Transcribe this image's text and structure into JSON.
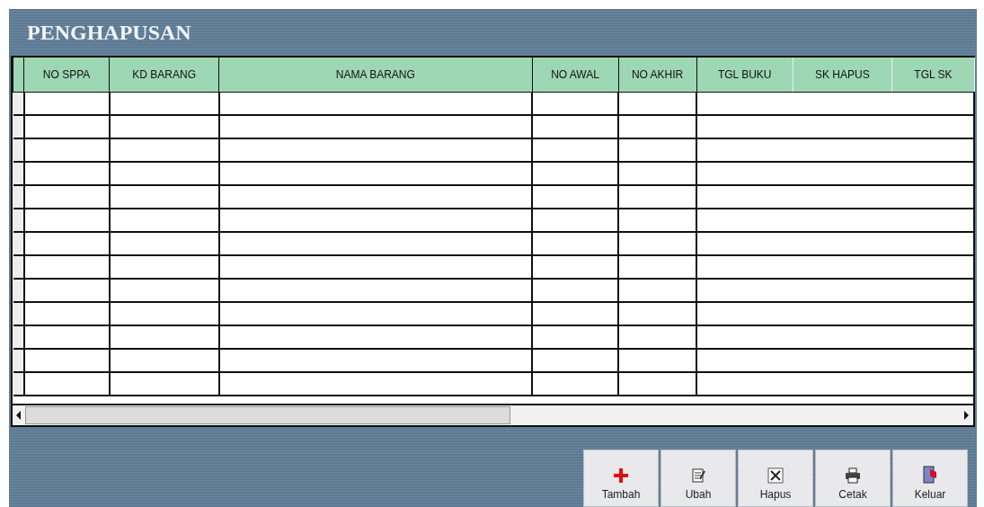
{
  "title": "PENGHAPUSAN",
  "table": {
    "columns": [
      "NO SPPA",
      "KD BARANG",
      "NAMA BARANG",
      "NO AWAL",
      "NO AKHIR",
      "TGL BUKU",
      "SK HAPUS",
      "TGL SK"
    ]
  },
  "buttons": [
    {
      "label": "Tambah",
      "kind": "add"
    },
    {
      "label": "Ubah",
      "kind": "edit"
    },
    {
      "label": "Hapus",
      "kind": "delete"
    },
    {
      "label": "Cetak",
      "kind": "print"
    },
    {
      "label": "Keluar",
      "kind": "exit"
    }
  ]
}
